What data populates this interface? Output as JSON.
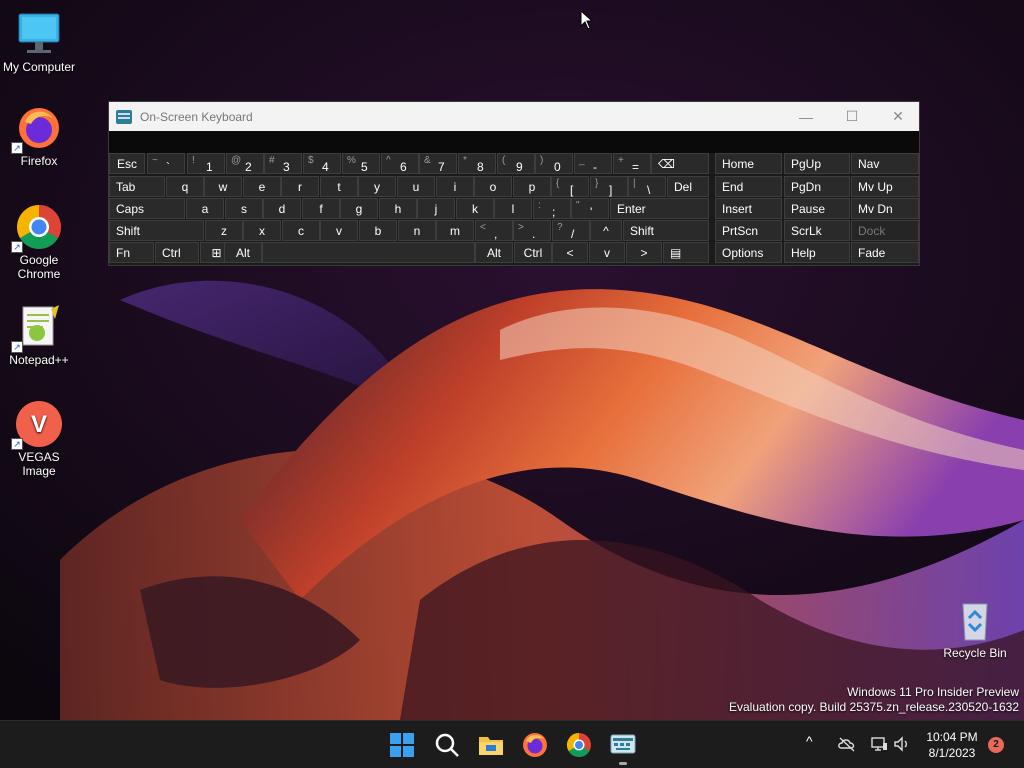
{
  "desktop_icons": [
    {
      "label": "My Computer",
      "icon": "monitor-icon"
    },
    {
      "label": "Firefox",
      "icon": "firefox-icon"
    },
    {
      "label": "Google Chrome",
      "icon": "chrome-icon"
    },
    {
      "label": "Notepad++",
      "icon": "notepadpp-icon"
    },
    {
      "label": "VEGAS Image",
      "icon": "vegas-icon",
      "glyph": "V"
    },
    {
      "label": "Recycle Bin",
      "icon": "recycle-bin-icon"
    }
  ],
  "shortcut_glyph": "↗",
  "osk": {
    "title": "On-Screen Keyboard",
    "controls": {
      "minimize": "—",
      "maximize": "☐",
      "close": "✕"
    },
    "row1": [
      {
        "main": "Esc"
      },
      {
        "sub": "~",
        "main": "`"
      },
      {
        "sub": "!",
        "main": "1"
      },
      {
        "sub": "@",
        "main": "2"
      },
      {
        "sub": "#",
        "main": "3"
      },
      {
        "sub": "$",
        "main": "4"
      },
      {
        "sub": "%",
        "main": "5"
      },
      {
        "sub": "^",
        "main": "6"
      },
      {
        "sub": "&",
        "main": "7"
      },
      {
        "sub": "*",
        "main": "8"
      },
      {
        "sub": "(",
        "main": "9"
      },
      {
        "sub": ")",
        "main": "0"
      },
      {
        "sub": "_",
        "main": "-"
      },
      {
        "sub": "+",
        "main": "="
      },
      {
        "main": "⌫"
      }
    ],
    "row2": [
      {
        "main": "Tab"
      },
      {
        "main": "q"
      },
      {
        "main": "w"
      },
      {
        "main": "e"
      },
      {
        "main": "r"
      },
      {
        "main": "t"
      },
      {
        "main": "y"
      },
      {
        "main": "u"
      },
      {
        "main": "i"
      },
      {
        "main": "o"
      },
      {
        "main": "p"
      },
      {
        "sub": "{",
        "main": "["
      },
      {
        "sub": "}",
        "main": "]"
      },
      {
        "sub": "|",
        "main": "\\"
      },
      {
        "main": "Del"
      }
    ],
    "row3": [
      {
        "main": "Caps"
      },
      {
        "main": "a"
      },
      {
        "main": "s"
      },
      {
        "main": "d"
      },
      {
        "main": "f"
      },
      {
        "main": "g"
      },
      {
        "main": "h"
      },
      {
        "main": "j"
      },
      {
        "main": "k"
      },
      {
        "main": "l"
      },
      {
        "sub": ":",
        "main": ";"
      },
      {
        "sub": "\"",
        "main": "'"
      },
      {
        "main": "Enter"
      }
    ],
    "row4": [
      {
        "main": "Shift"
      },
      {
        "main": "z"
      },
      {
        "main": "x"
      },
      {
        "main": "c"
      },
      {
        "main": "v"
      },
      {
        "main": "b"
      },
      {
        "main": "n"
      },
      {
        "main": "m"
      },
      {
        "sub": "<",
        "main": ","
      },
      {
        "sub": ">",
        "main": "."
      },
      {
        "sub": "?",
        "main": "/"
      },
      {
        "main": "^"
      },
      {
        "main": "Shift"
      }
    ],
    "row5": [
      {
        "main": "Fn"
      },
      {
        "main": "Ctrl"
      },
      {
        "main": "⊞"
      },
      {
        "main": "Alt"
      },
      {
        "main": ""
      },
      {
        "main": "Alt"
      },
      {
        "main": "Ctrl"
      },
      {
        "main": "<"
      },
      {
        "main": "v"
      },
      {
        "main": ">"
      },
      {
        "main": "▤"
      }
    ],
    "nav": [
      [
        "Home",
        "PgUp",
        "Nav"
      ],
      [
        "End",
        "PgDn",
        "Mv Up"
      ],
      [
        "Insert",
        "Pause",
        "Mv Dn"
      ],
      [
        "PrtScn",
        "ScrLk",
        "Dock"
      ],
      [
        "Options",
        "Help",
        "Fade"
      ]
    ]
  },
  "watermark": {
    "line1": "Windows 11 Pro Insider Preview",
    "line2": "Evaluation copy. Build 25375.zn_release.230520-1632"
  },
  "taskbar": {
    "apps": [
      "start-icon",
      "search-icon",
      "file-explorer-icon",
      "firefox-icon",
      "chrome-icon",
      "on-screen-keyboard-icon"
    ],
    "tray": {
      "chevron": "^"
    },
    "time": "10:04 PM",
    "date": "8/1/2023",
    "notification_count": "2"
  }
}
